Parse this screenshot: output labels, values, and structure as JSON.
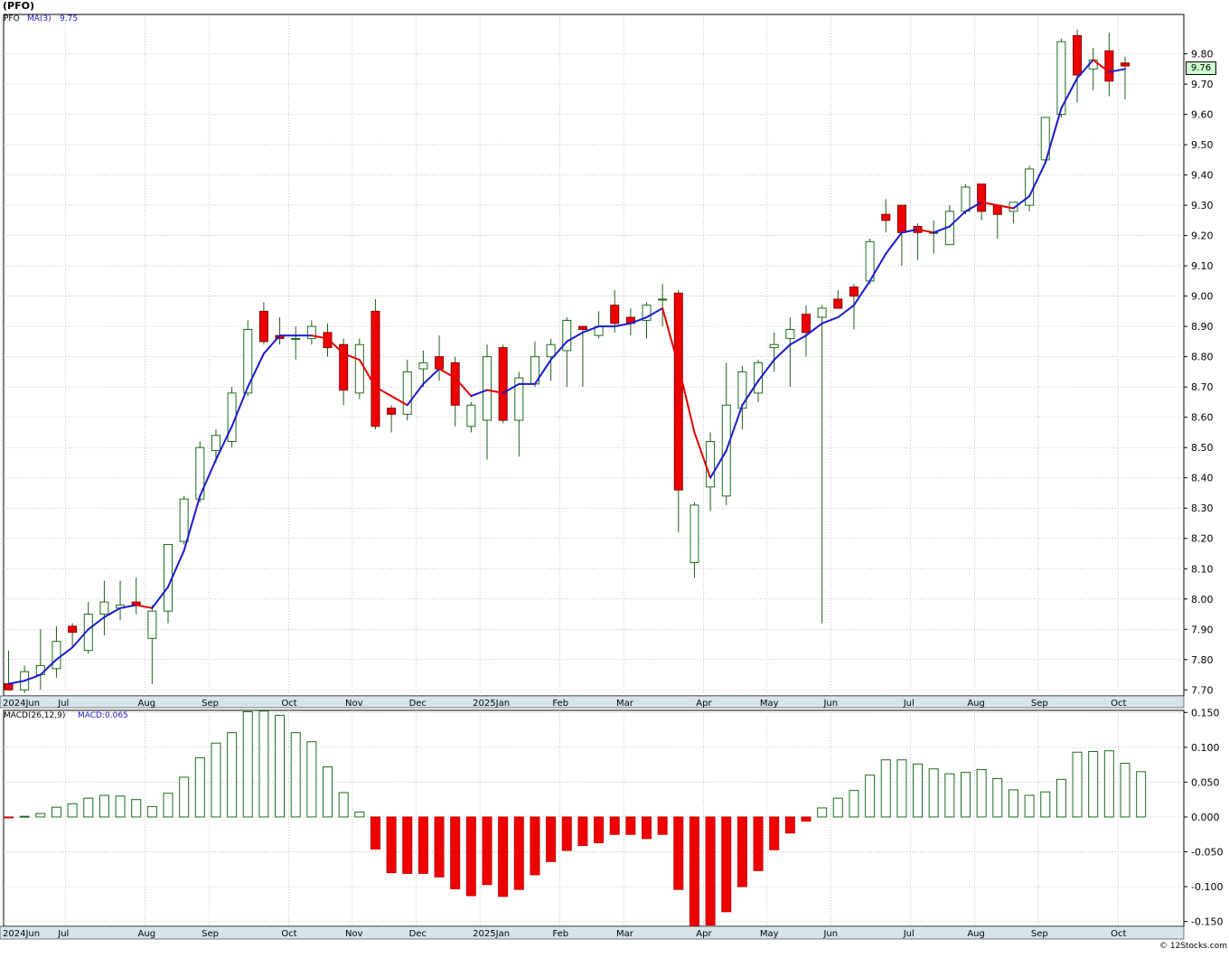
{
  "header": {
    "title": "(PFO)",
    "symbol": "PFO",
    "ma_label": "MA(3)",
    "ma_value": "9.75",
    "last_price": "9.76"
  },
  "macd_header": {
    "label": "MACD(26,12,9)",
    "value": "MACD:0.065"
  },
  "copyright": "© 12Stocks.com",
  "colors": {
    "up_fill": "#ffffff",
    "up_stroke": "#1e6b1e",
    "down_fill": "#ee0000",
    "ma_up": "#1a1acc",
    "ma_down": "#e60000",
    "axis_bg": "#d6e4ec",
    "grid": "#b0b0b0"
  },
  "chart_data": [
    {
      "type": "candlestick",
      "title": "(PFO)",
      "period": "weekly",
      "ylim": [
        7.68,
        9.93
      ],
      "y_ticks": [
        "9.80",
        "9.70",
        "9.60",
        "9.50",
        "9.40",
        "9.30",
        "9.20",
        "9.10",
        "9.00",
        "8.90",
        "8.80",
        "8.70",
        "8.60",
        "8.50",
        "8.40",
        "8.30",
        "8.20",
        "8.10",
        "8.00",
        "7.90",
        "7.80",
        "7.70"
      ],
      "x_month_labels": [
        {
          "label": "2024Jun",
          "index": 0
        },
        {
          "label": "Jul",
          "index": 4
        },
        {
          "label": "Aug",
          "index": 9
        },
        {
          "label": "Sep",
          "index": 13
        },
        {
          "label": "Oct",
          "index": 18
        },
        {
          "label": "Nov",
          "index": 22
        },
        {
          "label": "Dec",
          "index": 26
        },
        {
          "label": "2025Jan",
          "index": 30
        },
        {
          "label": "Feb",
          "index": 35
        },
        {
          "label": "Mar",
          "index": 39
        },
        {
          "label": "Apr",
          "index": 44
        },
        {
          "label": "May",
          "index": 48
        },
        {
          "label": "Jun",
          "index": 52
        },
        {
          "label": "Jul",
          "index": 57
        },
        {
          "label": "Aug",
          "index": 61
        },
        {
          "label": "Sep",
          "index": 65
        },
        {
          "label": "Oct",
          "index": 70
        }
      ],
      "ohlc": [
        [
          7.72,
          7.83,
          7.7,
          7.7
        ],
        [
          7.7,
          7.78,
          7.69,
          7.76
        ],
        [
          7.75,
          7.9,
          7.7,
          7.78
        ],
        [
          7.77,
          7.91,
          7.74,
          7.86
        ],
        [
          7.91,
          7.92,
          7.84,
          7.89
        ],
        [
          7.83,
          7.99,
          7.82,
          7.95
        ],
        [
          7.95,
          8.06,
          7.88,
          7.99
        ],
        [
          7.97,
          8.06,
          7.93,
          7.98
        ],
        [
          7.99,
          8.07,
          7.95,
          7.98
        ],
        [
          7.87,
          7.98,
          7.72,
          7.96
        ],
        [
          7.96,
          8.0,
          7.92,
          8.18
        ],
        [
          8.19,
          8.34,
          8.18,
          8.33
        ],
        [
          8.33,
          8.52,
          8.32,
          8.5
        ],
        [
          8.49,
          8.56,
          8.45,
          8.54
        ],
        [
          8.52,
          8.7,
          8.5,
          8.68
        ],
        [
          8.68,
          8.92,
          8.67,
          8.89
        ],
        [
          8.95,
          8.98,
          8.84,
          8.85
        ],
        [
          8.87,
          8.93,
          8.84,
          8.86
        ],
        [
          8.86,
          8.9,
          8.79,
          8.86
        ],
        [
          8.86,
          8.92,
          8.84,
          8.9
        ],
        [
          8.88,
          8.91,
          8.8,
          8.83
        ],
        [
          8.84,
          8.86,
          8.64,
          8.69
        ],
        [
          8.68,
          8.86,
          8.66,
          8.84
        ],
        [
          8.95,
          8.99,
          8.56,
          8.57
        ],
        [
          8.63,
          8.64,
          8.55,
          8.61
        ],
        [
          8.61,
          8.79,
          8.59,
          8.75
        ],
        [
          8.76,
          8.82,
          8.7,
          8.78
        ],
        [
          8.8,
          8.87,
          8.72,
          8.76
        ],
        [
          8.78,
          8.8,
          8.57,
          8.64
        ],
        [
          8.57,
          8.65,
          8.55,
          8.64
        ],
        [
          8.59,
          8.84,
          8.46,
          8.8
        ],
        [
          8.83,
          8.84,
          8.58,
          8.59
        ],
        [
          8.59,
          8.75,
          8.47,
          8.73
        ],
        [
          8.71,
          8.85,
          8.7,
          8.8
        ],
        [
          8.8,
          8.86,
          8.72,
          8.84
        ],
        [
          8.82,
          8.93,
          8.7,
          8.92
        ],
        [
          8.9,
          8.9,
          8.7,
          8.89
        ],
        [
          8.87,
          8.95,
          8.86,
          8.9
        ],
        [
          8.97,
          9.02,
          8.88,
          8.91
        ],
        [
          8.93,
          8.96,
          8.87,
          8.91
        ],
        [
          8.92,
          8.98,
          8.86,
          8.97
        ],
        [
          8.99,
          9.04,
          8.9,
          8.99
        ],
        [
          9.01,
          9.02,
          8.22,
          8.36
        ],
        [
          8.12,
          8.32,
          8.07,
          8.31
        ],
        [
          8.37,
          8.55,
          8.29,
          8.52
        ],
        [
          8.34,
          8.78,
          8.31,
          8.64
        ],
        [
          8.63,
          8.77,
          8.56,
          8.75
        ],
        [
          8.68,
          8.79,
          8.65,
          8.78
        ],
        [
          8.83,
          8.88,
          8.75,
          8.84
        ],
        [
          8.86,
          8.93,
          8.7,
          8.89
        ],
        [
          8.94,
          8.97,
          8.8,
          8.88
        ],
        [
          8.93,
          8.97,
          7.92,
          8.96
        ],
        [
          8.99,
          9.02,
          8.96,
          8.96
        ],
        [
          9.03,
          9.04,
          8.89,
          9.0
        ],
        [
          9.05,
          9.19,
          9.04,
          9.18
        ],
        [
          9.27,
          9.32,
          9.21,
          9.25
        ],
        [
          9.3,
          9.3,
          9.1,
          9.21
        ],
        [
          9.23,
          9.24,
          9.12,
          9.21
        ],
        [
          9.21,
          9.25,
          9.14,
          9.21
        ],
        [
          9.17,
          9.3,
          9.17,
          9.28
        ],
        [
          9.28,
          9.37,
          9.27,
          9.36
        ],
        [
          9.37,
          9.37,
          9.25,
          9.28
        ],
        [
          9.3,
          9.3,
          9.19,
          9.27
        ],
        [
          9.28,
          9.31,
          9.24,
          9.31
        ],
        [
          9.3,
          9.43,
          9.28,
          9.42
        ],
        [
          9.45,
          9.59,
          9.44,
          9.59
        ],
        [
          9.6,
          9.85,
          9.59,
          9.84
        ],
        [
          9.86,
          9.88,
          9.64,
          9.73
        ],
        [
          9.75,
          9.82,
          9.68,
          9.78
        ],
        [
          9.81,
          9.87,
          9.66,
          9.71
        ],
        [
          9.77,
          9.79,
          9.65,
          9.76
        ]
      ],
      "ma3": [
        7.72,
        7.73,
        7.75,
        7.8,
        7.84,
        7.9,
        7.94,
        7.97,
        7.98,
        7.97,
        8.04,
        8.16,
        8.34,
        8.46,
        8.57,
        8.7,
        8.81,
        8.87,
        8.87,
        8.87,
        8.86,
        8.81,
        8.79,
        8.7,
        8.67,
        8.64,
        8.71,
        8.76,
        8.73,
        8.67,
        8.69,
        8.68,
        8.71,
        8.71,
        8.79,
        8.85,
        8.88,
        8.9,
        8.9,
        8.91,
        8.93,
        8.96,
        8.77,
        8.55,
        8.4,
        8.49,
        8.64,
        8.72,
        8.79,
        8.84,
        8.87,
        8.91,
        8.93,
        8.97,
        9.05,
        9.14,
        9.21,
        9.22,
        9.21,
        9.23,
        9.28,
        9.31,
        9.3,
        9.29,
        9.33,
        9.44,
        9.62,
        9.72,
        9.78,
        9.74,
        9.75
      ]
    },
    {
      "type": "bar",
      "title": "MACD(26,12,9)",
      "ylim": [
        -0.157,
        0.153
      ],
      "y_ticks": [
        "0.150",
        "0.100",
        "0.050",
        "0.000",
        "-0.050",
        "-0.100",
        "-0.150"
      ],
      "values": [
        -0.001,
        0.001,
        0.005,
        0.014,
        0.019,
        0.027,
        0.031,
        0.03,
        0.025,
        0.015,
        0.034,
        0.057,
        0.085,
        0.106,
        0.121,
        0.151,
        0.152,
        0.146,
        0.121,
        0.108,
        0.072,
        0.035,
        0.007,
        -0.046,
        -0.08,
        -0.081,
        -0.081,
        -0.086,
        -0.103,
        -0.113,
        -0.097,
        -0.114,
        -0.104,
        -0.083,
        -0.064,
        -0.048,
        -0.041,
        -0.037,
        -0.025,
        -0.025,
        -0.031,
        -0.025,
        -0.104,
        -0.156,
        -0.155,
        -0.136,
        -0.1,
        -0.077,
        -0.047,
        -0.023,
        -0.006,
        0.013,
        0.027,
        0.038,
        0.06,
        0.082,
        0.082,
        0.076,
        0.069,
        0.062,
        0.064,
        0.068,
        0.055,
        0.039,
        0.031,
        0.036,
        0.054,
        0.093,
        0.094,
        0.095,
        0.077,
        0.065
      ]
    }
  ]
}
